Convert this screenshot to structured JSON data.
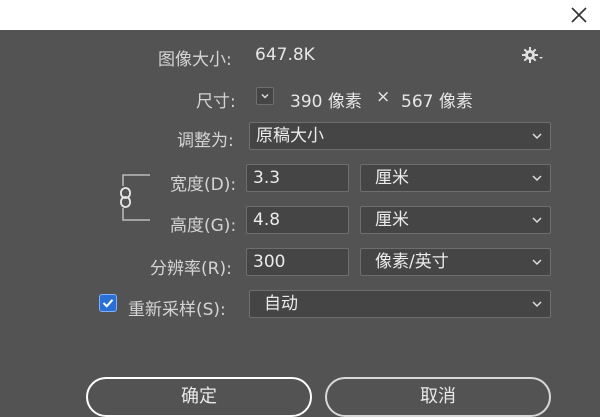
{
  "dialog": {
    "image_size_label": "图像大小:",
    "image_size_value": "647.8K",
    "dimensions_label": "尺寸:",
    "dimensions_width": "390 像素",
    "dimensions_times": "×",
    "dimensions_height": "567 像素",
    "fit_label": "调整为:",
    "fit_value": "原稿大小",
    "width_label": "宽度(D):",
    "width_value": "3.3",
    "width_unit": "厘米",
    "height_label": "高度(G):",
    "height_value": "4.8",
    "height_unit": "厘米",
    "resolution_label": "分辨率(R):",
    "resolution_value": "300",
    "resolution_unit": "像素/英寸",
    "resample_label": "重新采样(S):",
    "resample_checked": true,
    "resample_value": "自动",
    "ok_label": "确定",
    "cancel_label": "取消"
  },
  "icons": {
    "close": "close-icon",
    "gear": "gear-icon",
    "chain": "chain-link-icon",
    "chevron": "chevron-down-icon",
    "check": "checkmark-icon"
  },
  "colors": {
    "background": "#535353",
    "field": "#454545",
    "checkbox": "#2a6fd6"
  }
}
